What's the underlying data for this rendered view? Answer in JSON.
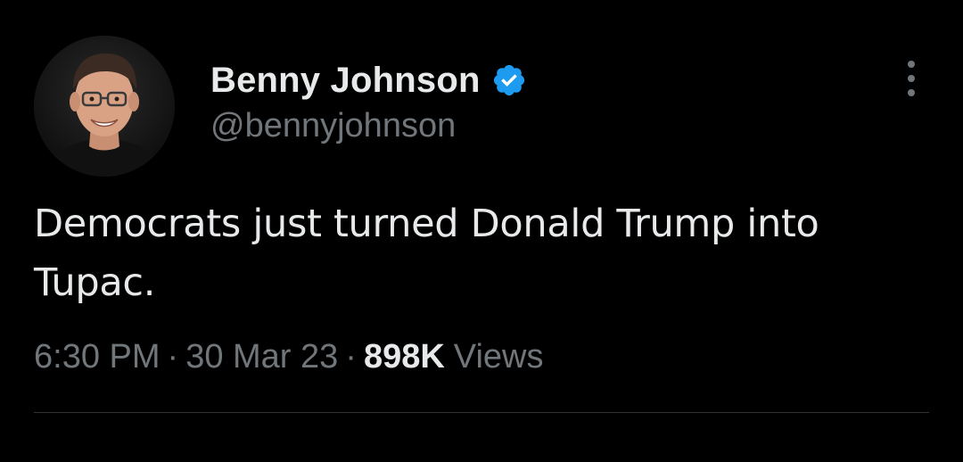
{
  "author": {
    "display_name": "Benny Johnson",
    "handle": "@bennyjohnson",
    "verified": true,
    "avatar_icon": "profile-photo",
    "verified_icon": "verified-badge-icon"
  },
  "tweet": {
    "text": "Democrats just turned Donald Trump into Tupac.",
    "time": "6:30 PM",
    "date": "30 Mar 23",
    "separator": "·",
    "views_count": "898K",
    "views_label": "Views"
  },
  "menu": {
    "icon": "more-vertical-icon"
  },
  "colors": {
    "background": "#000000",
    "primary_text": "#e7e9ea",
    "secondary_text": "#71767b",
    "verified_blue": "#1d9bf0",
    "divider": "#2f3336"
  }
}
